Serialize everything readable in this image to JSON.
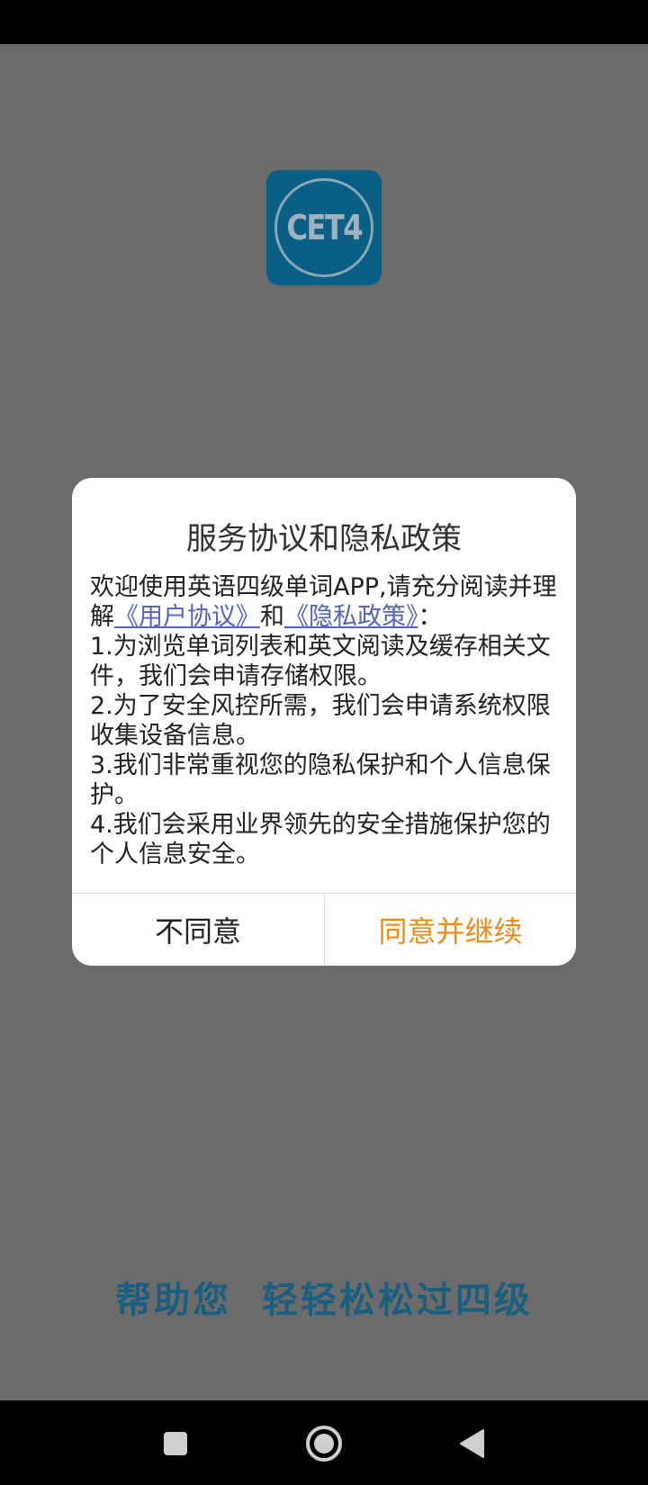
{
  "app": {
    "logo_text": "CET4",
    "slogan": "帮助您  轻轻松松过四级"
  },
  "dialog": {
    "title": "服务协议和隐私政策",
    "intro_before": "欢迎使用英语四级单词APP,请充分阅读并理解",
    "user_agreement_link": "《用户协议》",
    "and_text": "和",
    "privacy_policy_link": "《隐私政策》",
    "intro_after": "：",
    "items": [
      "1.为浏览单词列表和英文阅读及缓存相关文件，我们会申请存储权限。",
      "2.为了安全风控所需，我们会申请系统权限收集设备信息。",
      "3.我们非常重视您的隐私保护和个人信息保护。",
      "4.我们会采用业界领先的安全措施保护您的个人信息安全。"
    ],
    "disagree_label": "不同意",
    "agree_label": "同意并继续"
  },
  "colors": {
    "overlay_background": "#6b6b6b",
    "logo_background": "#0a5f86",
    "slogan": "#1a5f7f",
    "link": "#5563c1",
    "agree_button": "#f08a10"
  },
  "navigation": {
    "recents_icon": "square-icon",
    "home_icon": "circle-icon",
    "back_icon": "triangle-back-icon"
  }
}
